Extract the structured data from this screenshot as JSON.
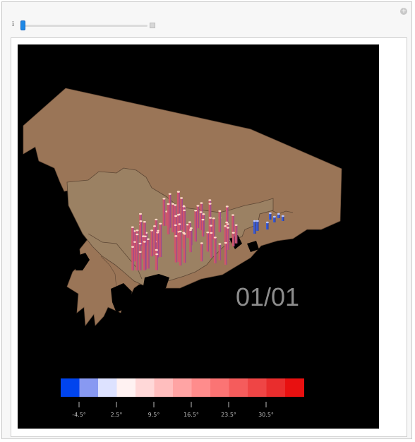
{
  "control": {
    "variable_label": "i",
    "slider_value_fraction": 0.0
  },
  "map": {
    "date_label": "01/01",
    "land_color": "#9a7557",
    "china_color": "#9b8163",
    "background_color": "#000000"
  },
  "legend": {
    "colors": [
      "#0044ee",
      "#8899f2",
      "#dde2ff",
      "#fff2f2",
      "#ffd8d8",
      "#ffbebe",
      "#ffa4a4",
      "#ff8c8c",
      "#fb7474",
      "#f55c5c",
      "#ef4545",
      "#e92d2d",
      "#e81010"
    ],
    "tick_labels": [
      "-4.5°",
      "2.5°",
      "9.5°",
      "16.5°",
      "23.5°",
      "30.5°"
    ]
  }
}
